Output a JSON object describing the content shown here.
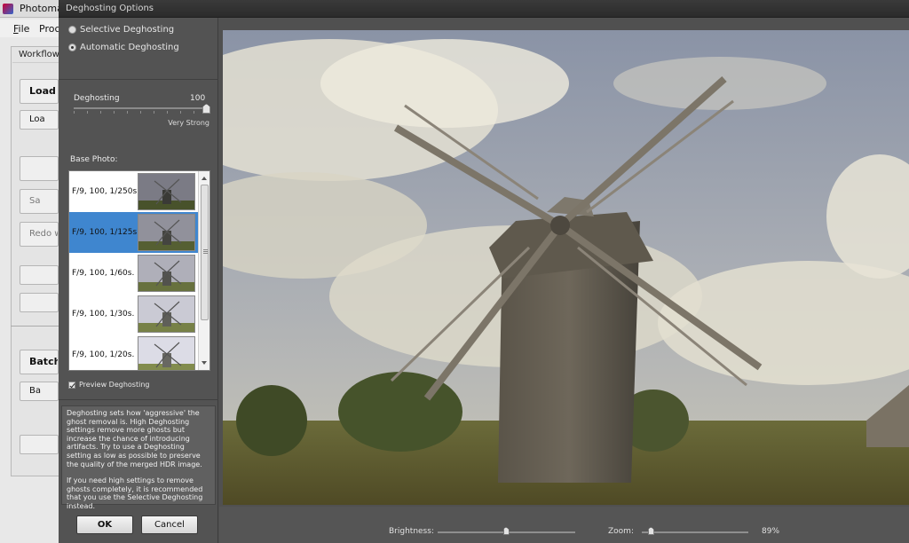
{
  "background_app": {
    "title": "Photoma",
    "menu": [
      {
        "accel": "F",
        "rest": "ile"
      },
      {
        "accel": "",
        "rest": "Proc"
      }
    ],
    "tab": "Workflow S",
    "buttons": [
      {
        "label": "Load",
        "big": true,
        "dim": false
      },
      {
        "label": "Loa",
        "big": false,
        "dim": false
      },
      {
        "label": "",
        "big": false,
        "dim": true
      },
      {
        "label": "Sa",
        "big": false,
        "dim": true
      },
      {
        "label": "Redo w",
        "big": false,
        "dim": true
      },
      {
        "label": "",
        "big": false,
        "dim": true
      },
      {
        "label": "",
        "big": false,
        "dim": true
      },
      {
        "label": "Batch",
        "big": true,
        "dim": false
      },
      {
        "label": "Ba",
        "big": false,
        "dim": false
      },
      {
        "label": "",
        "big": false,
        "dim": true
      }
    ]
  },
  "dialog": {
    "title": "Deghosting Options",
    "mode": {
      "options": [
        "Selective Deghosting",
        "Automatic Deghosting"
      ],
      "selected": "Automatic Deghosting"
    },
    "slider": {
      "label": "Deghosting",
      "value": "100",
      "caption": "Very Strong",
      "level": 1.0
    },
    "base_photo": {
      "label": "Base Photo:",
      "items": [
        {
          "label": "F/9, 100, 1/250s.",
          "brightness": 0.35
        },
        {
          "label": "F/9, 100, 1/125s.",
          "brightness": 0.5
        },
        {
          "label": "F/9, 100, 1/60s.",
          "brightness": 0.7
        },
        {
          "label": "F/9, 100, 1/30s.",
          "brightness": 0.88
        },
        {
          "label": "F/9, 100, 1/20s.",
          "brightness": 1.0
        }
      ],
      "selected_index": 1
    },
    "preview_checkbox": {
      "label": "Preview Deghosting",
      "checked": true
    },
    "help": {
      "p1": "Deghosting sets how 'aggressive' the ghost removal is. High Deghosting settings remove more ghosts but increase the chance of introducing artifacts. Try to use a Deghosting setting as low as possible to preserve the quality of the merged HDR image.",
      "p2": "If you need high settings to remove ghosts completely, it is recommended that you use the Selective Deghosting instead."
    },
    "ok_label": "OK",
    "cancel_label": "Cancel",
    "bottom": {
      "brightness_label": "Brightness:",
      "brightness_level": 0.5,
      "zoom_label": "Zoom:",
      "zoom_value": "89%",
      "zoom_level": 0.09
    }
  },
  "colors": {
    "dialog_bg": "#505050",
    "selection": "#3f86cf"
  }
}
